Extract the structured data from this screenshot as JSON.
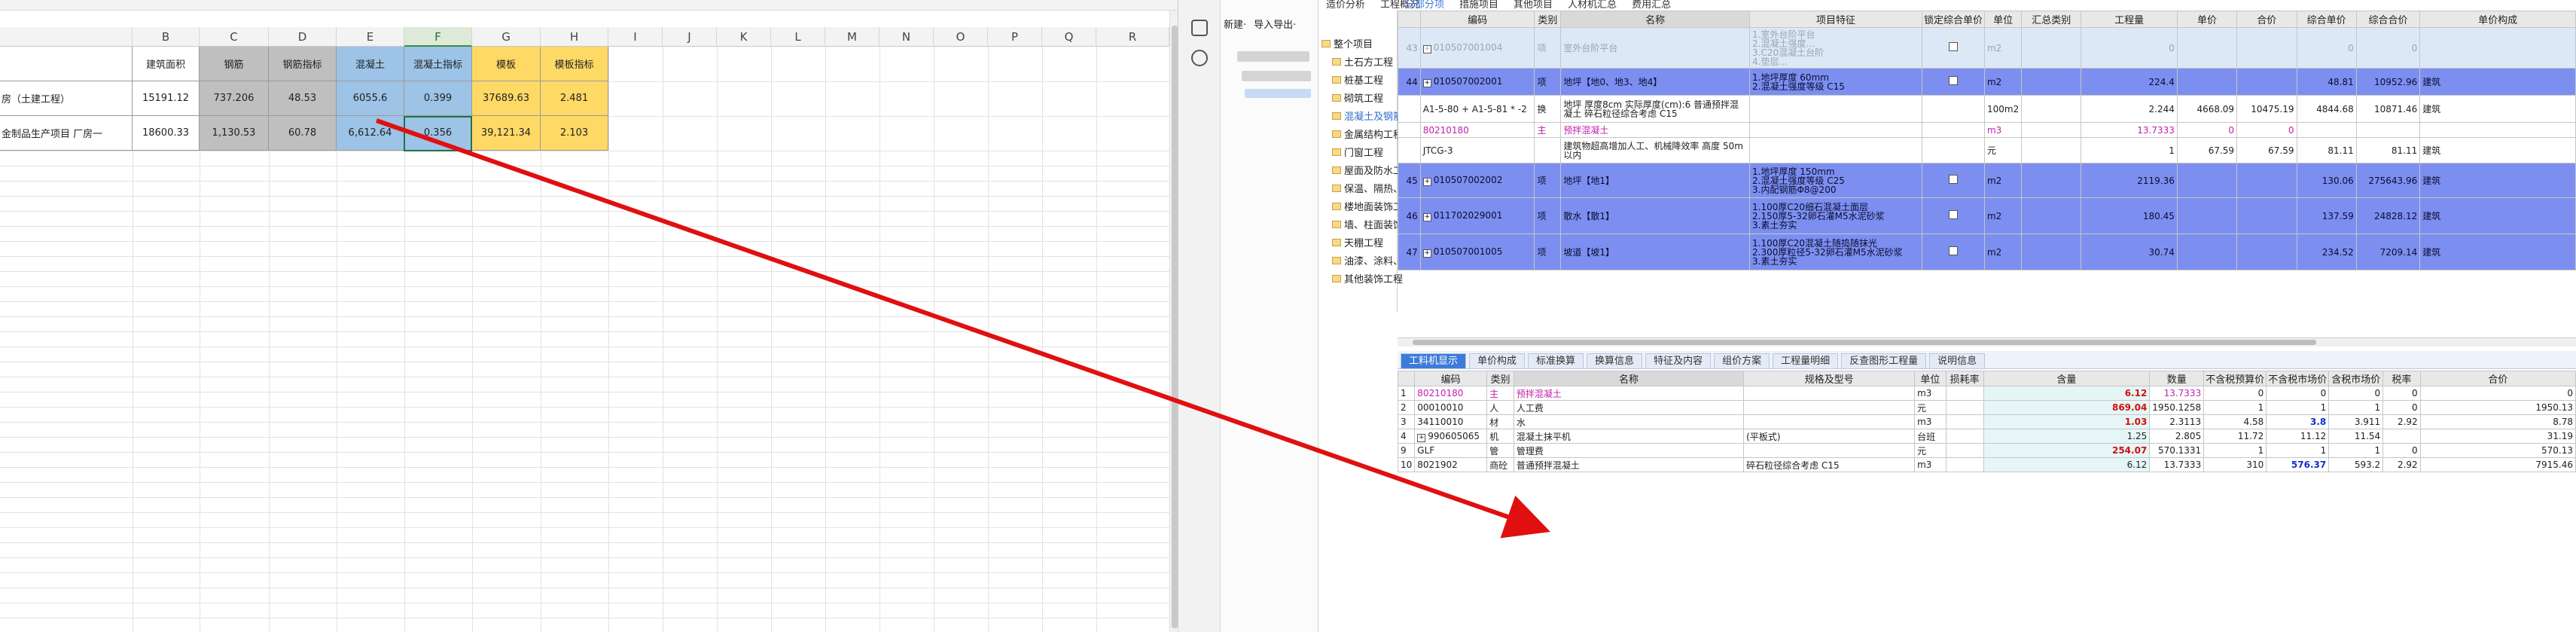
{
  "excel": {
    "col_letters": [
      "B",
      "C",
      "D",
      "E",
      "F",
      "G",
      "H",
      "I",
      "J",
      "K",
      "L",
      "M",
      "N",
      "O",
      "P",
      "Q",
      "R"
    ],
    "selected_col": "F",
    "header_row": [
      "建筑面积",
      "钢筋",
      "钢筋指标",
      "混凝土",
      "混凝土指标",
      "模板",
      "模板指标"
    ],
    "rows": [
      {
        "label": "房（土建工程）",
        "values": [
          "15191.12",
          "737.206",
          "48.53",
          "6055.6",
          "0.399",
          "37689.63",
          "2.481"
        ]
      },
      {
        "label": "金制品生产项目 厂房一",
        "values": [
          "18600.33",
          "1,130.53",
          "60.78",
          "6,612.64",
          "0.356",
          "39,121.34",
          "2.103"
        ]
      }
    ]
  },
  "soft": {
    "top_tabs": [
      "造价分析",
      "工程概况"
    ],
    "grid_top_tabs": [
      "分部分项",
      "措施项目",
      "其他项目",
      "人材机汇总",
      "费用汇总"
    ],
    "toolbar": {
      "new": "新建·",
      "import_export": "导入导出·"
    },
    "tree": {
      "root": "整个项目",
      "items": [
        "土石方工程",
        "桩基工程",
        "砌筑工程",
        "混凝土及钢筋混...",
        "金属结构工程",
        "门窗工程",
        "屋面及防水工程",
        "保温、隔热、防...",
        "楼地面装饰工程",
        "墙、柱面装饰与...",
        "天棚工程",
        "油漆、涂料、裱...",
        "其他装饰工程"
      ],
      "highlight_index": 3
    },
    "upper": {
      "headers": [
        "",
        "编码",
        "类别",
        "名称",
        "项目特征",
        "锁定综合单价",
        "单位",
        "汇总类别",
        "工程量",
        "单价",
        "合价",
        "综合单价",
        "综合合价",
        "单价构成"
      ],
      "rows": [
        {
          "style": "light",
          "no": "43",
          "code": "010507001004",
          "cat": "项",
          "name": "室外台阶平台",
          "feature": "1.室外台阶平台\n2.混凝土强度...\n3.C20混凝土台阶\n4.垫层...",
          "unit": "m2",
          "qty": "0",
          "uprice": "",
          "total": "",
          "cprice": "0",
          "ctotal": "0",
          "comp": ""
        },
        {
          "style": "dark",
          "no": "44",
          "code": "010507002001",
          "cat": "项",
          "name": "地坪【地0、地3、地4】",
          "feature": "1.地坪厚度 60mm\n2.混凝土强度等级 C15",
          "unit": "m2",
          "qty": "224.4",
          "uprice": "",
          "total": "",
          "cprice": "48.81",
          "ctotal": "10952.96",
          "comp": "建筑"
        },
        {
          "style": "white",
          "no": "",
          "code": "A1-5-80 + A1-5-81 * -2",
          "cat": "换",
          "name": "地坪 厚度8cm 实际厚度(cm):6 普通预拌混凝土 碎石粒径综合考虑 C15",
          "feature": "",
          "unit": "100m2",
          "qty": "2.244",
          "uprice": "4668.09",
          "total": "10475.19",
          "cprice": "4844.68",
          "ctotal": "10871.46",
          "comp": "建筑"
        },
        {
          "style": "mag",
          "no": "",
          "code": "80210180",
          "cat": "主",
          "name": "预拌混凝土",
          "feature": "",
          "unit": "m3",
          "qty": "13.7333",
          "uprice": "0",
          "total": "0",
          "cprice": "",
          "ctotal": "",
          "comp": ""
        },
        {
          "style": "white",
          "no": "",
          "code": "JTCG-3",
          "cat": "",
          "name": "建筑物超高增加人工、机械降效率 高度 50m以内",
          "feature": "",
          "unit": "元",
          "qty": "1",
          "uprice": "67.59",
          "total": "67.59",
          "cprice": "81.11",
          "ctotal": "81.11",
          "comp": "建筑"
        },
        {
          "style": "dark",
          "no": "45",
          "code": "010507002002",
          "cat": "项",
          "name": "地坪【地1】",
          "feature": "1.地坪厚度 150mm\n2.混凝土强度等级 C25\n3.内配钢筋Φ8@200",
          "unit": "m2",
          "qty": "2119.36",
          "uprice": "",
          "total": "",
          "cprice": "130.06",
          "ctotal": "275643.96",
          "comp": "建筑"
        },
        {
          "style": "dark",
          "no": "46",
          "code": "011702029001",
          "cat": "项",
          "name": "散水【散1】",
          "feature": "1.100厚C20细石混凝土面层\n2.150厚5-32卵石灌M5水泥砂浆\n3.素土夯实",
          "unit": "m2",
          "qty": "180.45",
          "uprice": "",
          "total": "",
          "cprice": "137.59",
          "ctotal": "24828.12",
          "comp": "建筑"
        },
        {
          "style": "dark",
          "no": "47",
          "code": "010507001005",
          "cat": "项",
          "name": "坡道【坡1】",
          "feature": "1.100厚C20混凝土随捣随抹光\n2.300厚粒径5-32卵石灌M5水泥砂浆\n3.素土夯实",
          "unit": "m2",
          "qty": "30.74",
          "uprice": "",
          "total": "",
          "cprice": "234.52",
          "ctotal": "7209.14",
          "comp": "建筑"
        }
      ]
    },
    "bottom_tabs": [
      "工料机显示",
      "单价构成",
      "标准换算",
      "换算信息",
      "特征及内容",
      "组价方案",
      "工程量明细",
      "反查图形工程量",
      "说明信息"
    ],
    "lower": {
      "headers": [
        "",
        "编码",
        "类别",
        "名称",
        "规格及型号",
        "单位",
        "损耗率",
        "含量",
        "数量",
        "不含税预算价",
        "不含税市场价",
        "含税市场价",
        "税率",
        "合价"
      ],
      "rows": [
        {
          "no": "1",
          "code": "80210180",
          "cat": "主",
          "name": "预拌混凝土",
          "spec": "",
          "unit": "m3",
          "loss": "",
          "content": "6.12",
          "qty": "13.7333",
          "p1": "0",
          "p2": "0",
          "p3": "0",
          "tax": "0",
          "sum": "0",
          "mag": true,
          "cstyle": "red"
        },
        {
          "no": "2",
          "code": "00010010",
          "cat": "人",
          "name": "人工费",
          "spec": "",
          "unit": "元",
          "loss": "",
          "content": "869.04",
          "qty": "1950.1258",
          "p1": "1",
          "p2": "1",
          "p3": "1",
          "tax": "0",
          "sum": "1950.13",
          "mag": false,
          "cstyle": "red"
        },
        {
          "no": "3",
          "code": "34110010",
          "cat": "材",
          "name": "水",
          "spec": "",
          "unit": "m3",
          "loss": "",
          "content": "1.03",
          "qty": "2.3113",
          "p1": "4.58",
          "p2": "3.8",
          "p3": "3.911",
          "tax": "2.92",
          "sum": "8.78",
          "mag": false,
          "cstyle": "red"
        },
        {
          "no": "4",
          "code": "990605065",
          "cat": "机",
          "name": "混凝土抹平机",
          "spec": "(平板式)",
          "unit": "台班",
          "loss": "",
          "content": "1.25",
          "qty": "2.805",
          "p1": "11.72",
          "p2": "11.12",
          "p3": "11.54",
          "tax": "",
          "sum": "31.19",
          "mag": false,
          "cstyle": ""
        },
        {
          "no": "9",
          "code": "GLF",
          "cat": "管",
          "name": "管理费",
          "spec": "",
          "unit": "元",
          "loss": "",
          "content": "254.07",
          "qty": "570.1331",
          "p1": "1",
          "p2": "1",
          "p3": "1",
          "tax": "0",
          "sum": "570.13",
          "mag": false,
          "cstyle": "red"
        },
        {
          "no": "10",
          "code": "8021902",
          "cat": "商砼",
          "name": "普通预拌混凝土",
          "spec": "碎石粒径综合考虑 C15",
          "unit": "m3",
          "loss": "",
          "content": "6.12",
          "qty": "13.7333",
          "p1": "310",
          "p2": "576.37",
          "p3": "593.2",
          "tax": "2.92",
          "sum": "7915.46",
          "mag": false,
          "cstyle": ""
        }
      ]
    }
  },
  "colors": {
    "gray": "#bfbfbf",
    "blue": "#9dc3e6",
    "yellow": "#ffd966",
    "row_dark": "#7c8ff0",
    "row_light": "#dde8f6",
    "arrow": "#e01010",
    "tab_active": "#3c7bd9"
  }
}
